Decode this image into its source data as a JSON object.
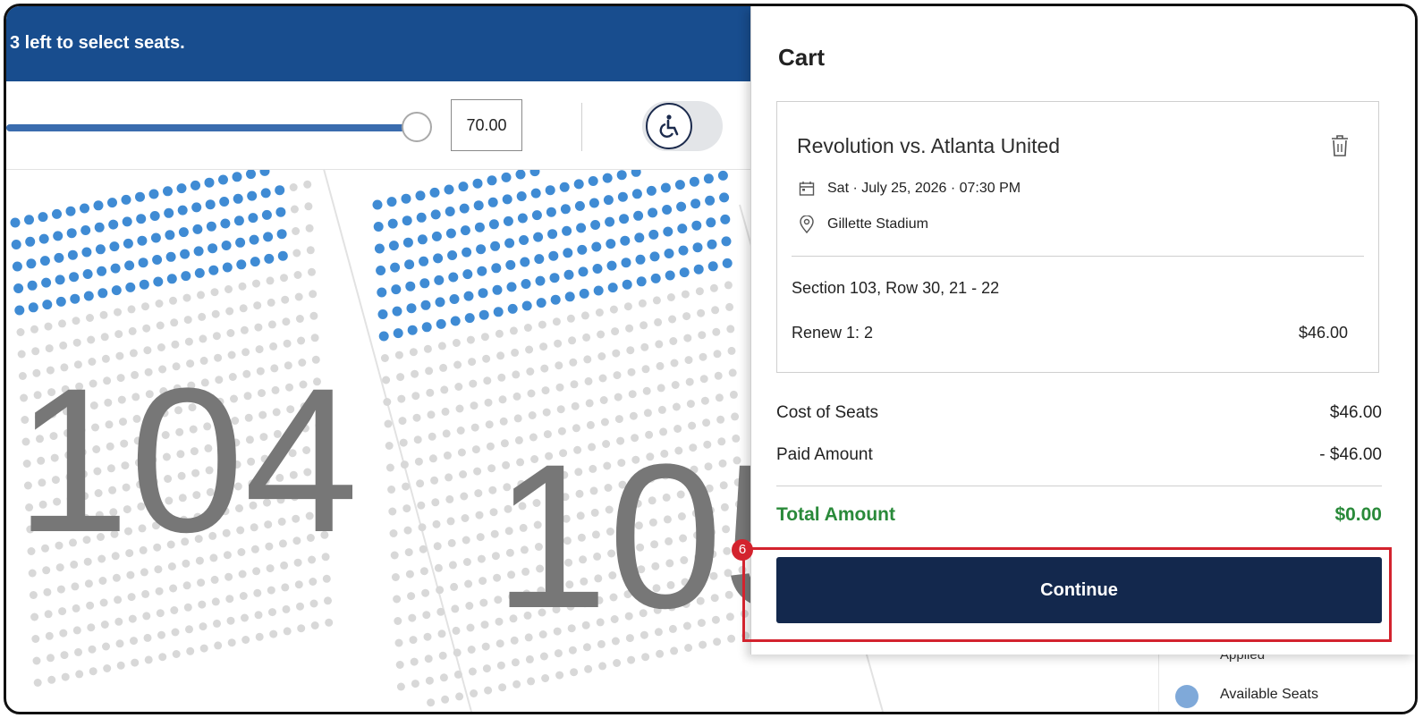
{
  "banner": {
    "text": "3 left to select seats."
  },
  "toolbar": {
    "price_value": "70.00",
    "slider_value_pct": 100
  },
  "map": {
    "sections": [
      {
        "label": "104"
      },
      {
        "label": "105"
      }
    ]
  },
  "cart": {
    "title": "Cart",
    "event_name": "Revolution vs. Atlanta United",
    "date": "Sat · July 25, 2026 · 07:30 PM",
    "venue": "Gillette Stadium",
    "seat_line": "Section 103, Row 30, 21 - 22",
    "renew_label": "Renew 1: 2",
    "renew_price": "$46.00",
    "cost_label": "Cost of Seats",
    "cost_value": "$46.00",
    "paid_label": "Paid Amount",
    "paid_value": "- $46.00",
    "total_label": "Total Amount",
    "total_value": "$0.00",
    "continue_label": "Continue"
  },
  "annotation": {
    "step_number": "6"
  },
  "legend": {
    "applied_label": "Applied",
    "available_label": "Available Seats"
  },
  "colors": {
    "brand_blue": "#184d8e",
    "button_navy": "#13284d",
    "total_green": "#2a8a3a",
    "highlight_red": "#d3232e",
    "seat_blue": "#3f8bd4",
    "seat_gray": "#d8d8d8"
  }
}
